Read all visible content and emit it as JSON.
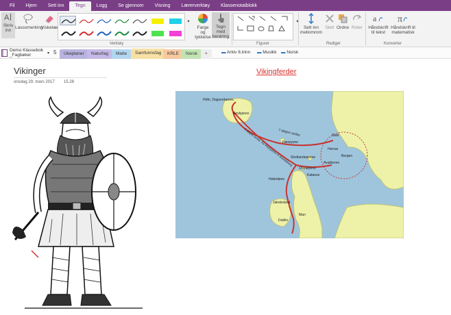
{
  "menu": {
    "tabs": [
      "Fil",
      "Hjem",
      "Sett inn",
      "Tegn",
      "Logg",
      "Se gjennom",
      "Visning",
      "Lærerverktøy",
      "Klassenotatblokk"
    ],
    "active": "Tegn"
  },
  "ribbon": {
    "skriv_inn": "Skriv inn",
    "lassomerking": "Lassomerking",
    "viskelaer": "Viskelær",
    "farge_tykkelse": "Farge og tykkelse",
    "tegn_med_beroring": "Tegn med berøring",
    "sett_inn_mellomrom": "Sett inn mellomrom",
    "slett": "Slett",
    "ordne": "Ordne",
    "roter": "Roter",
    "handskrift_tekst": "Håndskrift til tekst",
    "handskrift_matte": "Håndskrift til matematisk",
    "group_verktoy": "Verktøy",
    "group_figurer": "Figurer",
    "group_rediger": "Rediger",
    "group_konverter": "Konverter"
  },
  "notebook": {
    "name": "Demo Klassebok",
    "section_group": "_Fagbøker",
    "count": "5",
    "tabs": [
      {
        "label": "Ukeplaner",
        "color": "#b9b3e0"
      },
      {
        "label": "Naturfag",
        "color": "#c6b9e6"
      },
      {
        "label": "Matte",
        "color": "#b3d6f0"
      },
      {
        "label": "Samfunnsfag",
        "color": "#f7e0a6"
      },
      {
        "label": "KRLE",
        "color": "#f6c9a0"
      },
      {
        "label": "Norsk",
        "color": "#c2e4b5"
      }
    ],
    "add_tab": "+",
    "folders": [
      "Arkiv 8.trinn",
      "Musikk",
      "Norsk"
    ]
  },
  "page": {
    "title": "Vikinger",
    "date": "onsdag 29. mars 2017",
    "time": "15.28",
    "map_title": "Vikingferder"
  },
  "map_labels": {
    "hofn": "Höfn, Dagverðarnes",
    "reykjanes": "Reykjanes",
    "dogn7": "7 døgns seilas",
    "dogn2": "2 døgns seilas, fra Reykjanes til Islandsberg",
    "stad": "Stad",
    "faeroyene": "Færøyene",
    "hernar": "Hernar",
    "bergen": "Bergen",
    "shetland": "Shetlandsøyene",
    "avaldsnes": "Avaldsnes",
    "orknoyene": "Orknøyene",
    "kvanen": "Katanes",
    "hebridene": "Hebridene",
    "jakobsland": "Jakobsland",
    "man": "Man",
    "dublin": "Dublin"
  },
  "colors": {
    "accent": "#7a3e86",
    "sea": "#9fc5dd",
    "land": "#eef2a9",
    "route": "#c8322d"
  }
}
